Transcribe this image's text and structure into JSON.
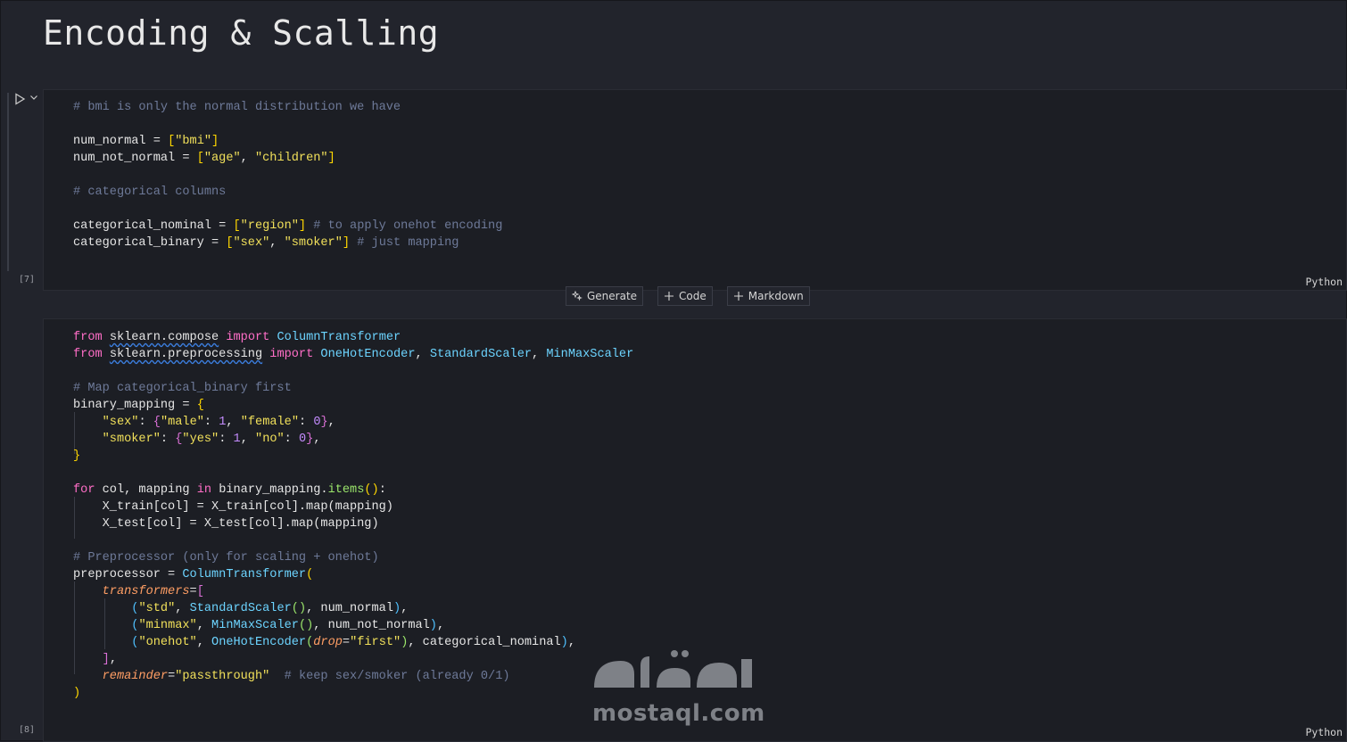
{
  "markdown": {
    "title": "Encoding & Scalling"
  },
  "cells": [
    {
      "exec_count": "[7]",
      "language": "Python"
    },
    {
      "exec_count": "[8]",
      "language": "Python"
    }
  ],
  "toolbar": {
    "generate_label": "Generate",
    "code_label": "Code",
    "markdown_label": "Markdown"
  },
  "watermark": {
    "text": "mostaql.com"
  },
  "colors": {
    "background": "#22242c",
    "cell_background": "#1c1e24",
    "comment": "#6e7a99",
    "string": "#f1e05a",
    "keyword": "#ff6ec7",
    "class": "#6cd4ff",
    "function": "#9be66b",
    "number": "#c58cff",
    "param": "#ff9e64"
  },
  "icons": {
    "run": "play-icon",
    "expand": "chevron-down-icon",
    "generate": "sparkle-icon",
    "add": "plus-icon"
  }
}
